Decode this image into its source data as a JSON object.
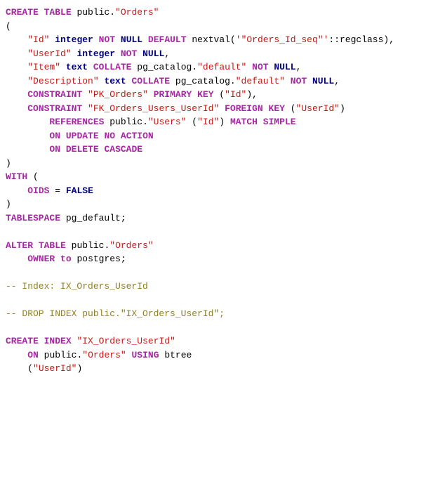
{
  "tokens": {
    "0": "CREATE",
    "1": "TABLE",
    "2": "public",
    "3": "\"Orders\"",
    "4": "\"Id\"",
    "5": "integer",
    "6": "NOT",
    "7": "NULL",
    "8": "DEFAULT",
    "9": "nextval",
    "10": "'\"Orders_Id_seq\"'",
    "11": "::regclass",
    "12": "\"UserId\"",
    "13": "\"Item\"",
    "14": "text",
    "15": "COLLATE",
    "16": "pg_catalog",
    "17": "\"default\"",
    "18": "\"Description\"",
    "19": "CONSTRAINT",
    "20": "\"PK_Orders\"",
    "21": "PRIMARY",
    "22": "KEY",
    "23": "\"FK_Orders_Users_UserId\"",
    "24": "FOREIGN",
    "25": "REFERENCES",
    "26": "\"Users\"",
    "27": "MATCH",
    "28": "SIMPLE",
    "29": "ON",
    "30": "UPDATE",
    "31": "NO",
    "32": "ACTION",
    "33": "DELETE",
    "34": "CASCADE",
    "35": "WITH",
    "36": "OIDS",
    "37": "FALSE",
    "38": "TABLESPACE",
    "39": "pg_default",
    "40": "ALTER",
    "41": "OWNER",
    "42": "to",
    "43": "postgres",
    "44": "-- Index: IX_Orders_UserId",
    "45": "-- DROP INDEX public.\"IX_Orders_UserId\";",
    "46": "INDEX",
    "47": "\"IX_Orders_UserId\"",
    "48": "USING",
    "49": "btree",
    "50": "\"UserId\"",
    "lparen": "(",
    "rparen": ")",
    "comma": ",",
    "semi": ";",
    "dot": ".",
    "eq": "="
  }
}
